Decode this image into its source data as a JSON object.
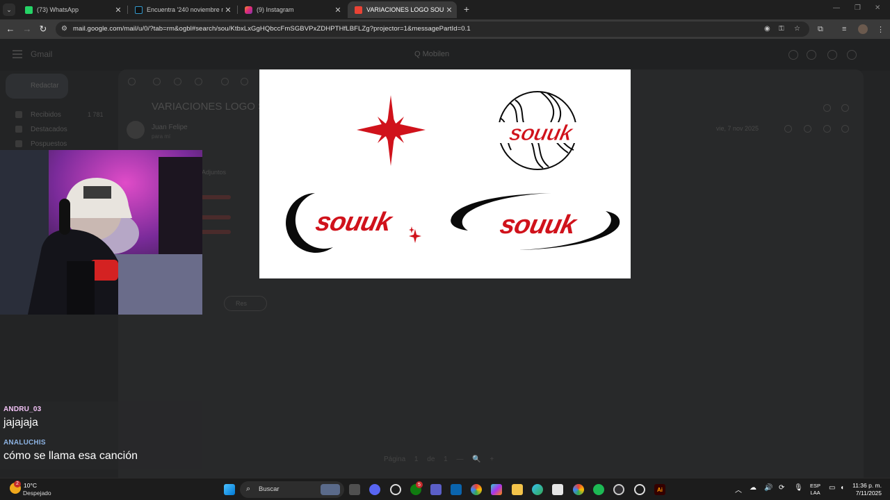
{
  "browser": {
    "tabs": [
      {
        "label": "(73) WhatsApp",
        "favicon": "whatsapp-icon",
        "color": "#25D366",
        "active": false
      },
      {
        "label": "Encuentra '240 noviembre med",
        "favicon": "tiktok-icon",
        "color": "#111111",
        "active": false
      },
      {
        "label": "(9) Instagram",
        "favicon": "instagram-icon",
        "color": "#E1306C",
        "active": false
      },
      {
        "label": "VARIACIONES LOGO SOUUK - j",
        "favicon": "gmail-icon",
        "color": "#EA4335",
        "active": true
      }
    ],
    "url": "mail.google.com/mail/u/0/?tab=rm&ogbl#search/sou/KtbxLxGgHQbccFmSGBVPxZDHPTHfLBFLZg?projector=1&messagePartId=0.1"
  },
  "gmail_background": {
    "logo_text": "Gmail",
    "header_mid": "Q Mobilen",
    "compose_label": "Redactar",
    "sidebar": [
      {
        "label": "Recibidos",
        "count": "1 781"
      },
      {
        "label": "Destacados",
        "count": ""
      },
      {
        "label": "Pospuestos",
        "count": ""
      }
    ],
    "subject": "VARIACIONES LOGO SO",
    "sender": "Juan Felipe",
    "to_me": "para mí",
    "date": "vie, 7 nov 2025",
    "attachments_label": "Adjuntos",
    "reply_label": "Res",
    "pager": "Página 1 de 1 — 🔍 +"
  },
  "preview_image": {
    "logos": [
      {
        "name": "logo-star-crescent",
        "text": ""
      },
      {
        "name": "logo-ball",
        "text": "souuk"
      },
      {
        "name": "logo-crescent-sparkle",
        "text": "souuk"
      },
      {
        "name": "logo-swoosh",
        "text": "souuk"
      }
    ],
    "colors": {
      "red": "#D0121B",
      "black": "#0a0a0a"
    }
  },
  "chat": [
    {
      "user": "ANDRU_03",
      "user_color": "#f3c3f7",
      "message": "jajajaja"
    },
    {
      "user": "ANALUCHIS",
      "user_color": "#8db3e2",
      "message": "cómo se llama esa canción"
    }
  ],
  "taskbar": {
    "weather_temp": "10°C",
    "weather_desc": "Despejado",
    "weather_badge": "2",
    "search_label": "Buscar",
    "lang_line1": "ESP",
    "lang_line2": "LAA",
    "time": "11:36 p. m.",
    "date": "7/11/2025",
    "icons": [
      "windows-start-icon",
      "file-explorer-task-icon",
      "discord-icon",
      "steam-icon",
      "xbox-icon",
      "teams-icon",
      "outlook-icon",
      "chrome-colorful-icon",
      "copilot-icon",
      "folder-icon",
      "edge-icon",
      "store-icon",
      "chrome-icon",
      "spotify-icon",
      "obs-icon",
      "search-lens-icon",
      "illustrator-icon"
    ],
    "xbox_badge": "5"
  }
}
